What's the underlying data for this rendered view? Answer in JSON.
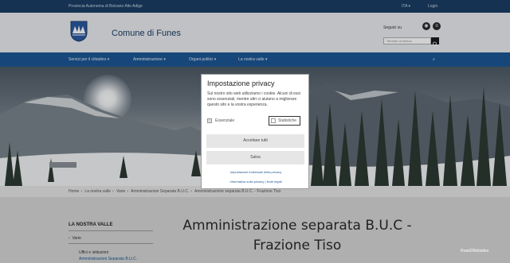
{
  "topbar": {
    "province": "Provincia Autonoma di Bolzano Alto Adige",
    "language": "ITA",
    "login": "Login"
  },
  "header": {
    "site_title": "Comune di Funes",
    "follow_label": "Seguici su",
    "search_placeholder": "Termine di ricerca"
  },
  "nav": {
    "items": [
      {
        "label": "Servizi per il cittadino"
      },
      {
        "label": "Amministrazione"
      },
      {
        "label": "Organi politici"
      },
      {
        "label": "La nostra valle"
      }
    ]
  },
  "breadcrumb": [
    "Home",
    "La nostra valle",
    "Varie",
    "Amministrazioni Separata B.U.C.",
    "Amministrazione separata B.U.C. - Frazione Tiso"
  ],
  "sidebar": {
    "title": "LA NOSTRA VALLE",
    "item": "Varie",
    "sub1": "Uffici e istituzioni",
    "sub2": "Amministrazioni Separata B.U.C."
  },
  "page_title": "Amministrazione separata B.U.C - Frazione Tiso",
  "modal": {
    "title": "Impostazione privacy",
    "text": "Sul nostro sito web utilizziamo i cookie. Alcuni di essi sono essenziali, mentre altri ci aiutano a migliorare questo sito e la vostra esperienza.",
    "essential_label": "Essenziale",
    "statistics_label": "Statistiche",
    "accept_all": "Accettare tutti",
    "save": "Salva",
    "individual_link": "Impostazioni individuali della privacy",
    "privacy_link": "Informativa sulla privacy | Note legali"
  },
  "corner_text": "Road2Websites"
}
